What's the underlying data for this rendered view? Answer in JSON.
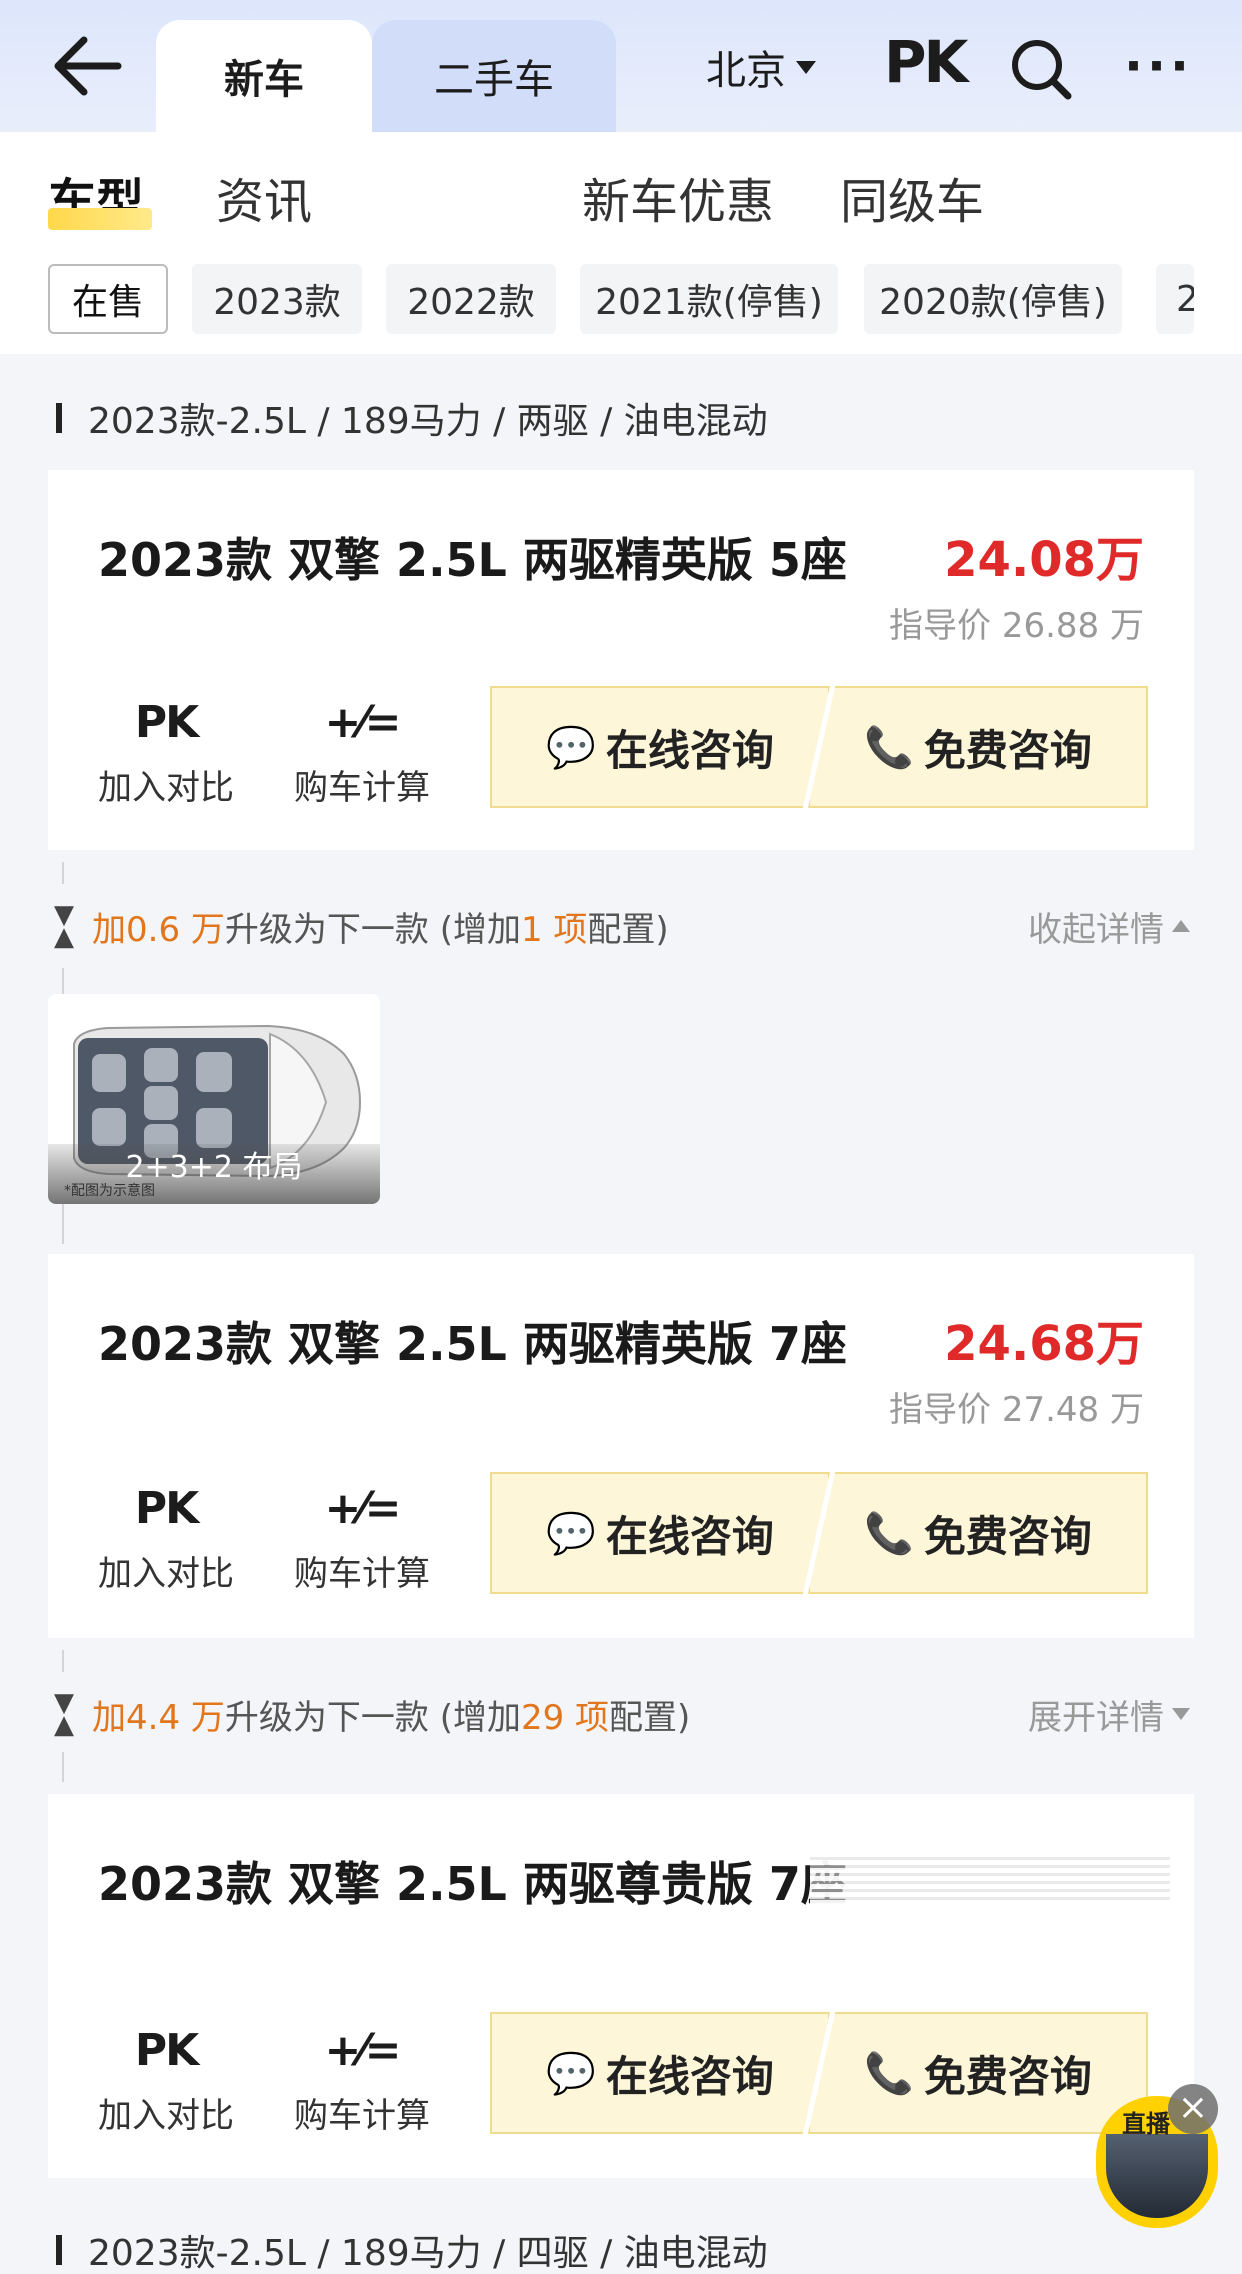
{
  "header": {
    "tabs": [
      {
        "label": "新车",
        "active": true
      },
      {
        "label": "二手车",
        "active": false
      }
    ],
    "city": "北京",
    "pk_label": "PK",
    "icons": [
      "back-arrow-icon",
      "search-icon",
      "more-icon"
    ]
  },
  "subnav": {
    "items": [
      "车型",
      "资讯",
      "新车优惠",
      "同级车"
    ],
    "active": "车型"
  },
  "filters": {
    "chips": [
      "在售",
      "2023款",
      "2022款",
      "2021款(停售)",
      "2020款(停售)",
      "2"
    ],
    "active": "在售"
  },
  "sections": [
    {
      "heading": "2023款-2.5L / 189马力 / 两驱 / 油电混动"
    },
    {
      "heading": "2023款-2.5L / 189马力 / 四驱 / 油电混动"
    }
  ],
  "cards": [
    {
      "title": "2023款 双擎 2.5L 两驱精英版 5座",
      "price": "24.08万",
      "guide": "指导价 26.88 万"
    },
    {
      "title": "2023款 双擎 2.5L 两驱精英版 7座",
      "price": "24.68万",
      "guide": "指导价 27.48 万"
    },
    {
      "title": "2023款 双擎 2.5L 两驱尊贵版 7座",
      "price": "",
      "guide": ""
    }
  ],
  "card_tools": {
    "pk_icon": "PK",
    "pk_label": "加入对比",
    "calc_icon": "+⁄=",
    "calc_label": "购车计算"
  },
  "card_buttons": {
    "online": "在线咨询",
    "free": "免费咨询"
  },
  "upgrades": [
    {
      "prefix": "加",
      "amount": "0.6 万",
      "middle": "升级为下一款 (增加 ",
      "count": "1 项",
      "suffix": "配置)",
      "toggle": "收起详情",
      "expanded": true
    },
    {
      "prefix": "加",
      "amount": "4.4 万",
      "middle": "升级为下一款 (增加 ",
      "count": "29 项",
      "suffix": "配置)",
      "toggle": "展开详情",
      "expanded": false
    }
  ],
  "layout_image": {
    "label": "2+3+2 布局",
    "note": "*配图为示意图"
  },
  "live_widget": {
    "tag": "直播",
    "close": "×"
  },
  "colors": {
    "price_red": "#e02a2a",
    "accent_orange": "#e2761c",
    "button_bg": "#fdf6d8",
    "highlight_yellow": "#ffd84a"
  }
}
